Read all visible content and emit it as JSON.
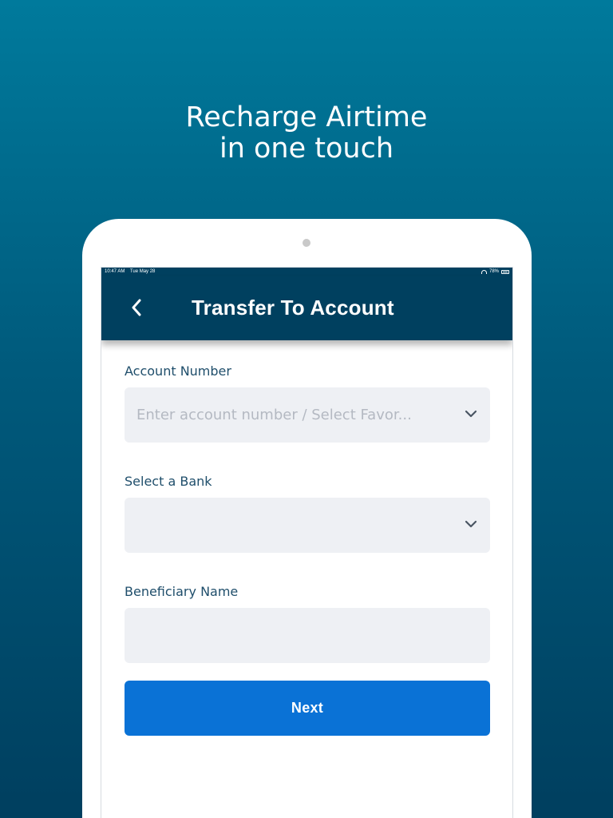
{
  "promo": {
    "line1": "Recharge Airtime",
    "line2": "in one touch"
  },
  "status_bar": {
    "time": "10:47 AM",
    "date": "Tue May 28",
    "battery": "78%"
  },
  "header": {
    "title": "Transfer To Account",
    "back_icon": "chevron-left-icon"
  },
  "form": {
    "account_number": {
      "label": "Account Number",
      "placeholder": "Enter account number / Select Favor...",
      "value": ""
    },
    "bank": {
      "label": "Select a Bank",
      "value": ""
    },
    "beneficiary": {
      "label": "Beneficiary Name",
      "value": ""
    },
    "next_label": "Next"
  },
  "colors": {
    "background_top": "#007a9c",
    "background_bottom": "#003f5f",
    "header_bg": "#00405f",
    "field_bg": "#eef0f4",
    "primary_button": "#0a72d6",
    "label_text": "#1f4e6b"
  }
}
